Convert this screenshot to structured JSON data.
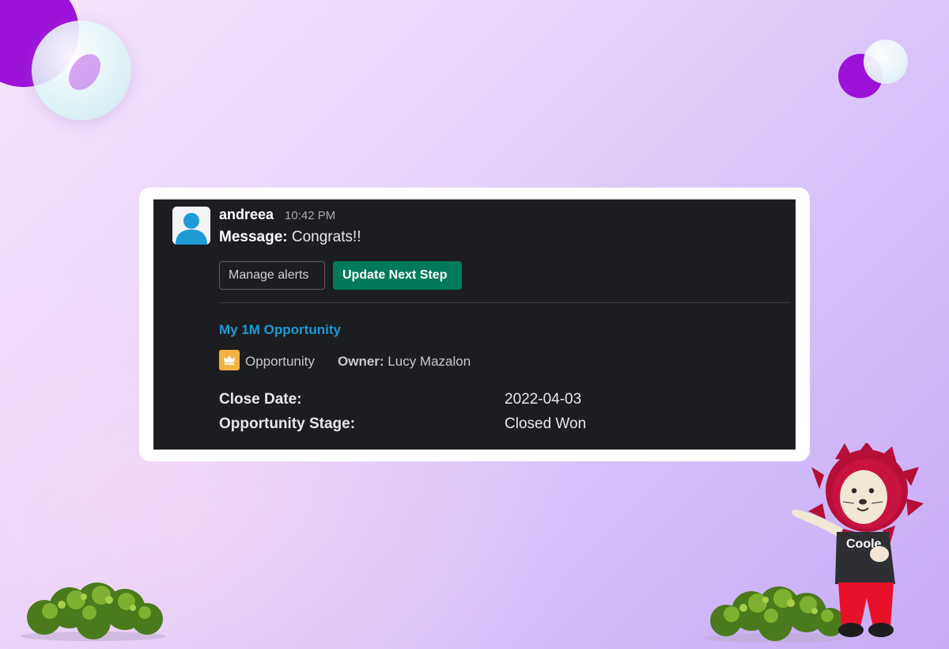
{
  "message": {
    "username": "andreea",
    "timestamp": "10:42 PM",
    "label": "Message:",
    "text": " Congrats!!"
  },
  "actions": {
    "manage_alerts": "Manage alerts",
    "update_next_step": "Update Next Step"
  },
  "record": {
    "link_text": "My 1M Opportunity",
    "type_icon": "crown-icon",
    "type": "Opportunity",
    "owner_label": "Owner:",
    "owner_name": " Lucy Mazalon"
  },
  "fields": [
    {
      "label": "Close Date:",
      "value": "2022-04-03"
    },
    {
      "label": "Opportunity Stage:",
      "value": "Closed Won"
    }
  ],
  "mascot": {
    "shirt_text": "Coole"
  },
  "colors": {
    "card_bg": "#1b1d21",
    "primary_button": "#007a5a",
    "link": "#1d9bd1",
    "crown_badge": "#f3b23f",
    "bubble_purple": "#9d12d9"
  }
}
